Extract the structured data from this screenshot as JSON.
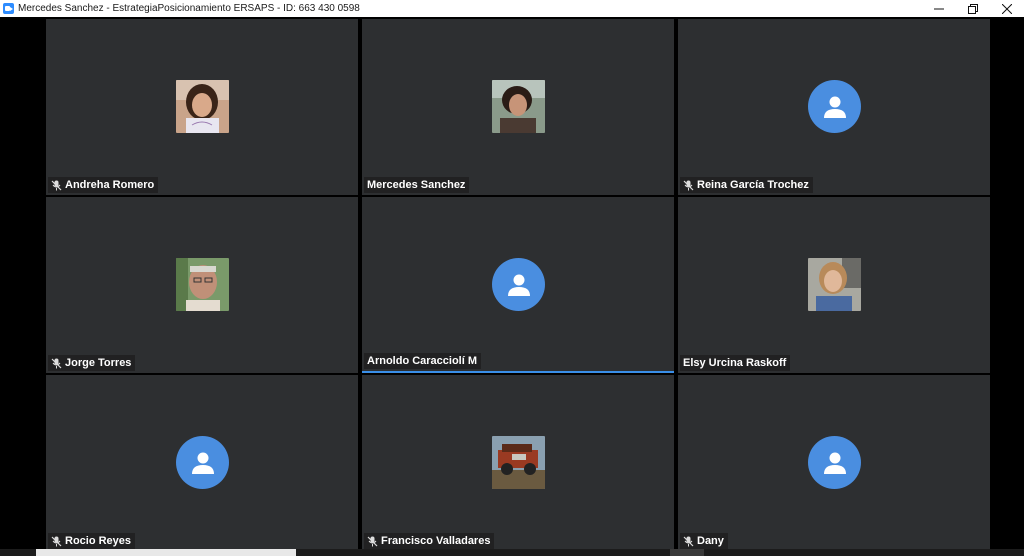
{
  "window": {
    "title": "Mercedes Sanchez - EstrategiaPosicionamiento ERSAPS - ID: 663 430 0598",
    "icon": "zoom-app-icon",
    "controls": [
      "minimize-icon",
      "restore-icon",
      "close-icon"
    ]
  },
  "colors": {
    "tile_bg": "#2d2f31",
    "default_avatar": "#4a8ee0",
    "active_speaker_border": "#3a8fe8",
    "title_bg": "#ffffff"
  },
  "participants": [
    {
      "name": "Andreha Romero",
      "muted": true,
      "avatar": "photo"
    },
    {
      "name": "Mercedes Sanchez",
      "muted": false,
      "avatar": "photo"
    },
    {
      "name": "Reina García Trochez",
      "muted": true,
      "avatar": "default-user-icon"
    },
    {
      "name": "Jorge Torres",
      "muted": true,
      "avatar": "photo"
    },
    {
      "name": "Arnoldo Caracciolí M",
      "muted": false,
      "avatar": "default-user-icon",
      "active_speaker": true
    },
    {
      "name": "Elsy Urcina Raskoff",
      "muted": false,
      "avatar": "photo"
    },
    {
      "name": "Rocio Reyes",
      "muted": true,
      "avatar": "default-user-icon"
    },
    {
      "name": "Francisco Valladares",
      "muted": true,
      "avatar": "photo"
    },
    {
      "name": "Dany",
      "muted": true,
      "avatar": "default-user-icon"
    }
  ]
}
